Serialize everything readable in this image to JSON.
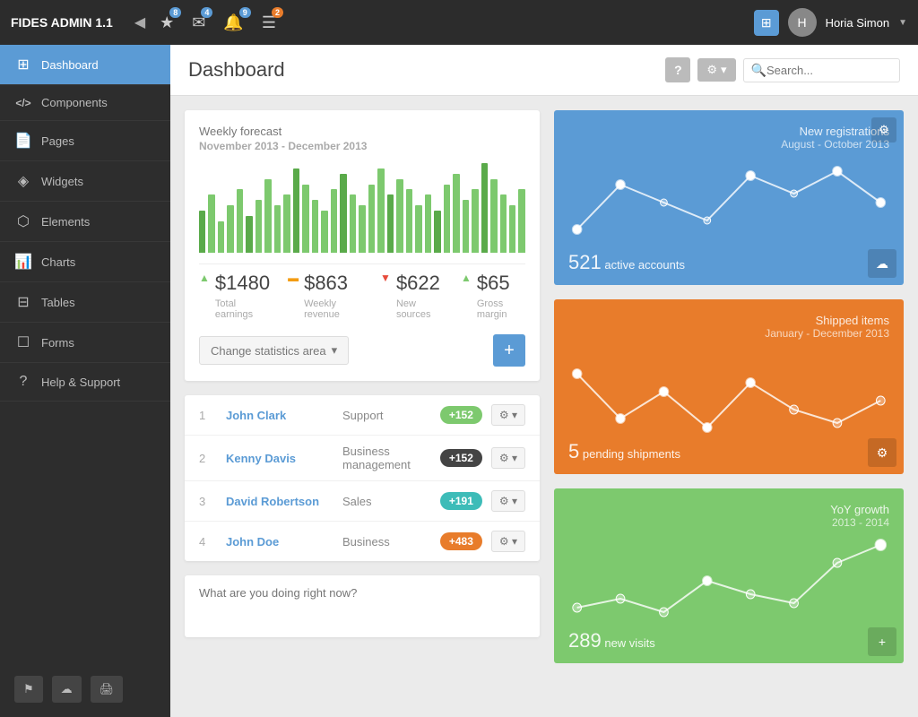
{
  "app": {
    "title": "FIDES ADMIN 1.1",
    "toggle_icon": "◀"
  },
  "topbar": {
    "icons": [
      {
        "id": "star",
        "symbol": "★",
        "badge": "8",
        "badge_color": "blue"
      },
      {
        "id": "mail",
        "symbol": "✉",
        "badge": "4",
        "badge_color": "blue"
      },
      {
        "id": "bell",
        "symbol": "🔔",
        "badge": "9",
        "badge_color": "blue"
      },
      {
        "id": "list",
        "symbol": "☰",
        "badge": "2",
        "badge_color": "orange"
      }
    ],
    "grid_icon": "⊞",
    "user": {
      "name": "Horia Simon",
      "caret": "▼"
    }
  },
  "sidebar": {
    "items": [
      {
        "id": "dashboard",
        "label": "Dashboard",
        "icon": "⊞",
        "active": true
      },
      {
        "id": "components",
        "label": "Components",
        "icon": "</>",
        "active": false
      },
      {
        "id": "pages",
        "label": "Pages",
        "icon": "⬜",
        "active": false
      },
      {
        "id": "widgets",
        "label": "Widgets",
        "icon": "◈",
        "active": false
      },
      {
        "id": "elements",
        "label": "Elements",
        "icon": "⬡",
        "active": false
      },
      {
        "id": "charts",
        "label": "Charts",
        "icon": "📊",
        "active": false
      },
      {
        "id": "tables",
        "label": "Tables",
        "icon": "⊟",
        "active": false
      },
      {
        "id": "forms",
        "label": "Forms",
        "icon": "☐",
        "active": false
      },
      {
        "id": "help",
        "label": "Help & Support",
        "icon": "?",
        "active": false
      }
    ],
    "bottom_buttons": [
      {
        "id": "flag",
        "symbol": "⚑"
      },
      {
        "id": "cloud",
        "symbol": "☁"
      },
      {
        "id": "print",
        "symbol": "🖨"
      }
    ]
  },
  "page": {
    "title": "Dashboard",
    "help_label": "?",
    "gear_label": "⚙",
    "search_placeholder": "Search..."
  },
  "forecast": {
    "title": "Weekly forecast",
    "period": "November 2013 - December 2013",
    "bars": [
      40,
      55,
      30,
      45,
      60,
      35,
      50,
      70,
      45,
      55,
      80,
      65,
      50,
      40,
      60,
      75,
      55,
      45,
      65,
      80,
      55,
      70,
      60,
      45,
      55,
      40,
      65,
      75,
      50,
      60,
      85,
      70,
      55,
      45,
      60
    ],
    "stats": [
      {
        "id": "total",
        "arrow": "up",
        "value": "$1480",
        "label": "Total earnings"
      },
      {
        "id": "weekly",
        "arrow": "neutral",
        "value": "$863",
        "label": "Weekly revenue"
      },
      {
        "id": "new_source",
        "arrow": "down",
        "value": "$622",
        "label": "New sources"
      },
      {
        "id": "gross",
        "arrow": "up",
        "value": "$65",
        "label": "Gross margin"
      }
    ],
    "change_area_label": "Change statistics area",
    "add_label": "+"
  },
  "table": {
    "rows": [
      {
        "num": "1",
        "name": "John Clark",
        "dept": "Support",
        "badge": "+152",
        "badge_type": "green"
      },
      {
        "num": "2",
        "name": "Kenny Davis",
        "dept": "Business management",
        "badge": "+152",
        "badge_type": "dark"
      },
      {
        "num": "3",
        "name": "David Robertson",
        "dept": "Sales",
        "badge": "+191",
        "badge_type": "teal"
      },
      {
        "num": "4",
        "name": "John Doe",
        "dept": "Business",
        "badge": "+483",
        "badge_type": "orange"
      }
    ],
    "gear_label": "⚙ ▾"
  },
  "textarea": {
    "placeholder": "What are you doing right now?"
  },
  "panels": [
    {
      "id": "registrations",
      "color": "blue",
      "title": "New registrations",
      "period": "August - October 2013",
      "stat_value": "521",
      "stat_label": "active accounts",
      "action_icon": "☁",
      "gear_icon": "⚙",
      "line_points": "10,80 60,30 110,50 160,70 210,20 260,40 310,15 360,50"
    },
    {
      "id": "shipments",
      "color": "orange",
      "title": "Shipped items",
      "period": "January - December 2013",
      "stat_value": "5",
      "stat_label": "pending shipments",
      "action_icon": "⚙",
      "gear_icon": "",
      "line_points": "10,30 60,80 110,50 160,90 210,40 260,70 310,85 360,60"
    },
    {
      "id": "growth",
      "color": "green",
      "title": "YoY growth",
      "period": "2013 - 2014",
      "stat_value": "289",
      "stat_label": "new visits",
      "action_icon": "+",
      "gear_icon": "",
      "line_points": "10,80 60,70 110,85 160,50 210,65 260,75 310,30 360,10"
    }
  ]
}
